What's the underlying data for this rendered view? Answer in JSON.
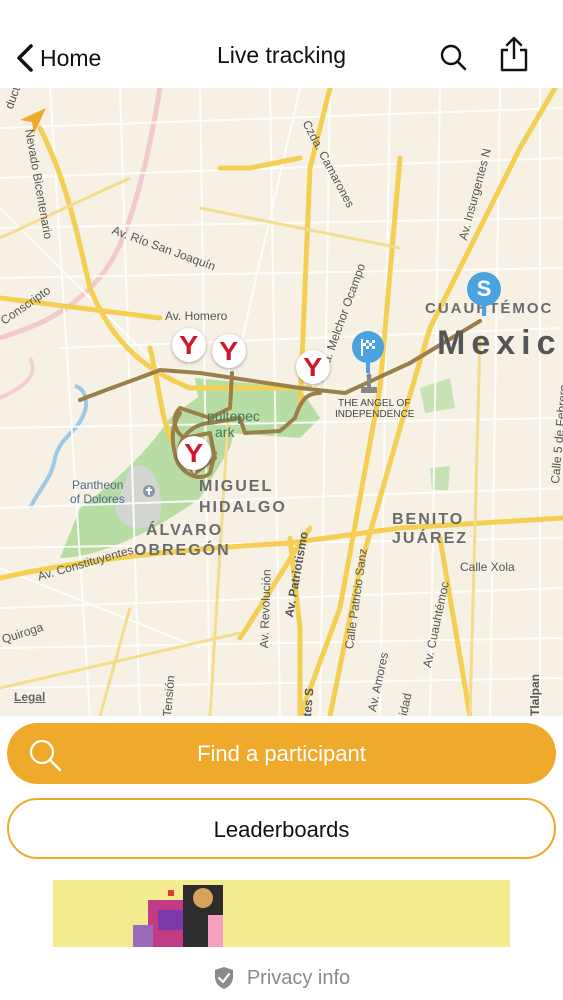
{
  "header": {
    "back_label": "Home",
    "title": "Live tracking"
  },
  "icons": {
    "back": "chevron-left-icon",
    "search": "search-icon",
    "share": "share-icon",
    "locate": "location-arrow-icon",
    "checkpoint": "checkpoint-y-icon",
    "start": "start-s-icon",
    "finish": "finish-flag-icon",
    "privacy": "shield-check-icon"
  },
  "map": {
    "streets": {
      "viaducto": "ducto",
      "nevado": "Nevado Bicentenario",
      "conscripto": "Conscripto",
      "rio_san_joaquin": "Av. Río San Joaquín",
      "homero": "Av. Homero",
      "camarones": "Czda. Camarones",
      "melchor_ocampo": "Czda. Melchor Ocampo",
      "insurgentes_n": "Av. Insurgentes N",
      "constituyentes": "Av. Constituyentes",
      "quiroga": "Quiroga",
      "patriotismo": "Av. Patriotismo",
      "revolucion": "Av. Revolución",
      "patricio_sanz": "Calle Patricio Sanz",
      "cuauhtemoc_av": "Av. Cuauhtémoc",
      "xola": "Calle Xola",
      "amores": "Av. Amores",
      "tlalpan": "Tlalpan",
      "calle5": "Calle 5 de Febrero",
      "tension": "Tensión",
      "insurgentes_s": "tes S",
      "idad": "idad"
    },
    "areas": {
      "cuauhtemoc": "CUAUHTÉMOC",
      "mexico": "Mexic",
      "miguel_hidalgo_1": "MIGUEL",
      "miguel_hidalgo_2": "HIDALGO",
      "alvaro_1": "ÁLVARO",
      "alvaro_2": "OBREGÓN",
      "benito_1": "BENITO",
      "benito_2": "JUÁREZ"
    },
    "pois": {
      "angel_1": "THE ANGEL OF",
      "angel_2": "INDEPENDENCE",
      "chapultepec_1": "pultepec",
      "chapultepec_2": "ark",
      "pantheon_1": "Pantheon",
      "pantheon_2": "of Dolores"
    },
    "start_letter": "S",
    "checkpoint_glyph": "Y",
    "legal": "Legal"
  },
  "buttons": {
    "find": "Find a participant",
    "leaderboards": "Leaderboards"
  },
  "footer": {
    "privacy": "Privacy info"
  },
  "colors": {
    "accent": "#efaa2b",
    "route": "#9b7f4a",
    "marker_blue": "#4aa3df",
    "checkpoint_red": "#d0172b"
  }
}
